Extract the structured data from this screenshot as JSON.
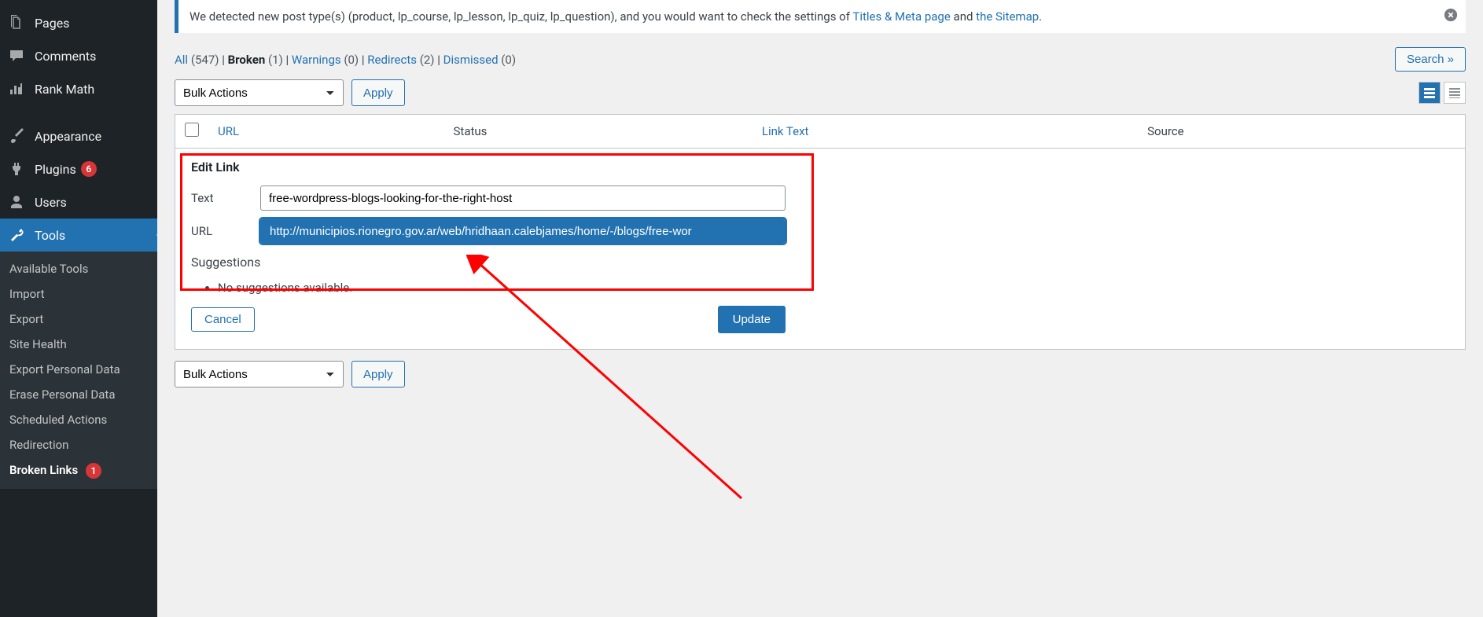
{
  "sidebar": {
    "pages": "Pages",
    "comments": "Comments",
    "rankmath": "Rank Math",
    "appearance": "Appearance",
    "plugins": "Plugins",
    "plugins_badge": "6",
    "users": "Users",
    "tools": "Tools",
    "sub_available": "Available Tools",
    "sub_import": "Import",
    "sub_export": "Export",
    "sub_site_health": "Site Health",
    "sub_export_pd": "Export Personal Data",
    "sub_erase_pd": "Erase Personal Data",
    "sub_scheduled": "Scheduled Actions",
    "sub_redirection": "Redirection",
    "sub_broken_links": "Broken Links",
    "broken_badge": "1"
  },
  "notice": {
    "pre": "We detected new post type(s) (product, lp_course, lp_lesson, lp_quiz, lp_question), and you would want to check the settings of ",
    "link1": "Titles & Meta page",
    "mid": " and ",
    "link2": "the Sitemap",
    "post": "."
  },
  "filters": {
    "all": "All",
    "all_count": "(547)",
    "broken": "Broken",
    "broken_count": "(1)",
    "warnings": "Warnings",
    "warnings_count": "(0)",
    "redirects": "Redirects",
    "redirects_count": "(2)",
    "dismissed": "Dismissed",
    "dismissed_count": "(0)"
  },
  "search": "Search »",
  "bulk": {
    "label": "Bulk Actions",
    "apply": "Apply"
  },
  "table": {
    "url": "URL",
    "status": "Status",
    "link_text": "Link Text",
    "source": "Source"
  },
  "edit": {
    "title": "Edit Link",
    "text_label": "Text",
    "text_value": "free-wordpress-blogs-looking-for-the-right-host",
    "url_label": "URL",
    "url_value": "http://municipios.rionegro.gov.ar/web/hridhaan.calebjames/home/-/blogs/free-wor",
    "suggestions_title": "Suggestions",
    "no_suggestions": "No suggestions available.",
    "cancel": "Cancel",
    "update": "Update"
  }
}
